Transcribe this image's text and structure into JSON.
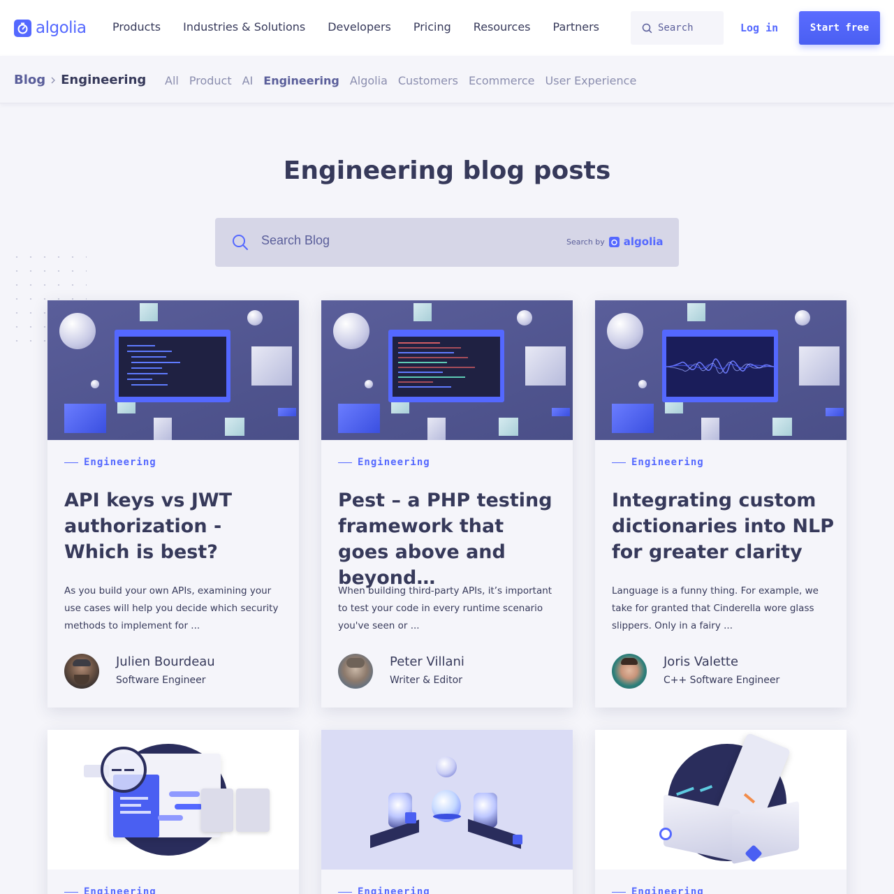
{
  "brand": {
    "name": "algolia",
    "color": "#5468ff"
  },
  "nav": {
    "links": [
      "Products",
      "Industries & Solutions",
      "Developers",
      "Pricing",
      "Resources",
      "Partners"
    ],
    "search_placeholder": "Search",
    "login_label": "Log in",
    "start_label": "Start free"
  },
  "subnav": {
    "breadcrumb": [
      "Blog",
      "Engineering"
    ],
    "categories": [
      "All",
      "Product",
      "AI",
      "Engineering",
      "Algolia",
      "Customers",
      "Ecommerce",
      "User Experience"
    ],
    "active_category": "Engineering"
  },
  "hero": {
    "title": "Engineering blog posts",
    "search_placeholder": "Search Blog",
    "search_by_label": "Search by",
    "search_by_brand": "algolia"
  },
  "posts": [
    {
      "tag": "Engineering",
      "title": "API keys vs JWT authorization - Which is best?",
      "excerpt": "As you build your own APIs, examining your use cases will help you decide which security methods to implement for ...",
      "author": "Julien Bourdeau",
      "role": "Software Engineer",
      "image": "code-screen-icon"
    },
    {
      "tag": "Engineering",
      "title": "Pest – a PHP testing framework that goes above and beyond…",
      "excerpt": "When building third-party APIs, it’s important to test your code in every runtime scenario you've seen or ...",
      "author": "Peter Villani",
      "role": "Writer & Editor",
      "image": "code-screen-icon"
    },
    {
      "tag": "Engineering",
      "title": "Integrating custom dictionaries into NLP for greater clarity",
      "excerpt": "Language is a funny thing. For example, we take for granted that Cinderella wore glass slippers. Only in a fairy ...",
      "author": "Joris Valette",
      "role": "C++ Software Engineer",
      "image": "waveform-screen-icon"
    },
    {
      "tag": "Engineering",
      "image": "magnifier-documents-icon"
    },
    {
      "tag": "Engineering",
      "image": "lab-machines-icon"
    },
    {
      "tag": "Engineering",
      "image": "open-book-ctrl-f-icon"
    }
  ]
}
